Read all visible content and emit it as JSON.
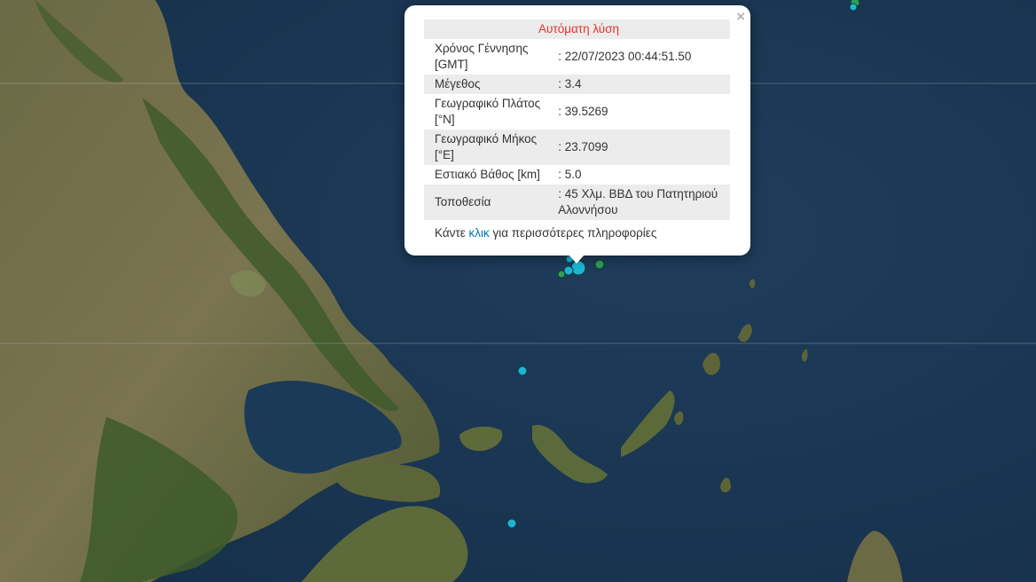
{
  "popup": {
    "title": "Αυτόματη λύση",
    "close": "×",
    "rows": [
      {
        "label_line1": "Χρόνος Γέννησης",
        "label_line2": "[GMT]",
        "value": ": 22/07/2023 00:44:51.50"
      },
      {
        "label_line1": "Μέγεθος",
        "label_line2": "",
        "value": ": 3.4"
      },
      {
        "label_line1": "Γεωγραφικό Πλάτος",
        "label_line2": "[°N]",
        "value": ": 39.5269"
      },
      {
        "label_line1": "Γεωγραφικό Μήκος",
        "label_line2": "[°E]",
        "value": ": 23.7099"
      },
      {
        "label_line1": "Εστιακό Βάθος [km]",
        "label_line2": "",
        "value": ": 5.0"
      },
      {
        "label_line1": "Τοποθεσία",
        "label_line2": "",
        "value_line1": ": 45 Χλμ. ΒΒΔ του Πατητηριού",
        "value_line2": "Αλοννήσου"
      }
    ],
    "more_prefix": "Κάντε ",
    "more_link": "κλικ",
    "more_suffix": " για περισσότερες πληροφορίες"
  },
  "colors": {
    "sea": "#1b3550",
    "land": "#5a6a3a",
    "quake_cyan": "#1fb5d0",
    "quake_green": "#2e9e5a",
    "title_red": "#e8332c",
    "link_blue": "#0078a8"
  }
}
